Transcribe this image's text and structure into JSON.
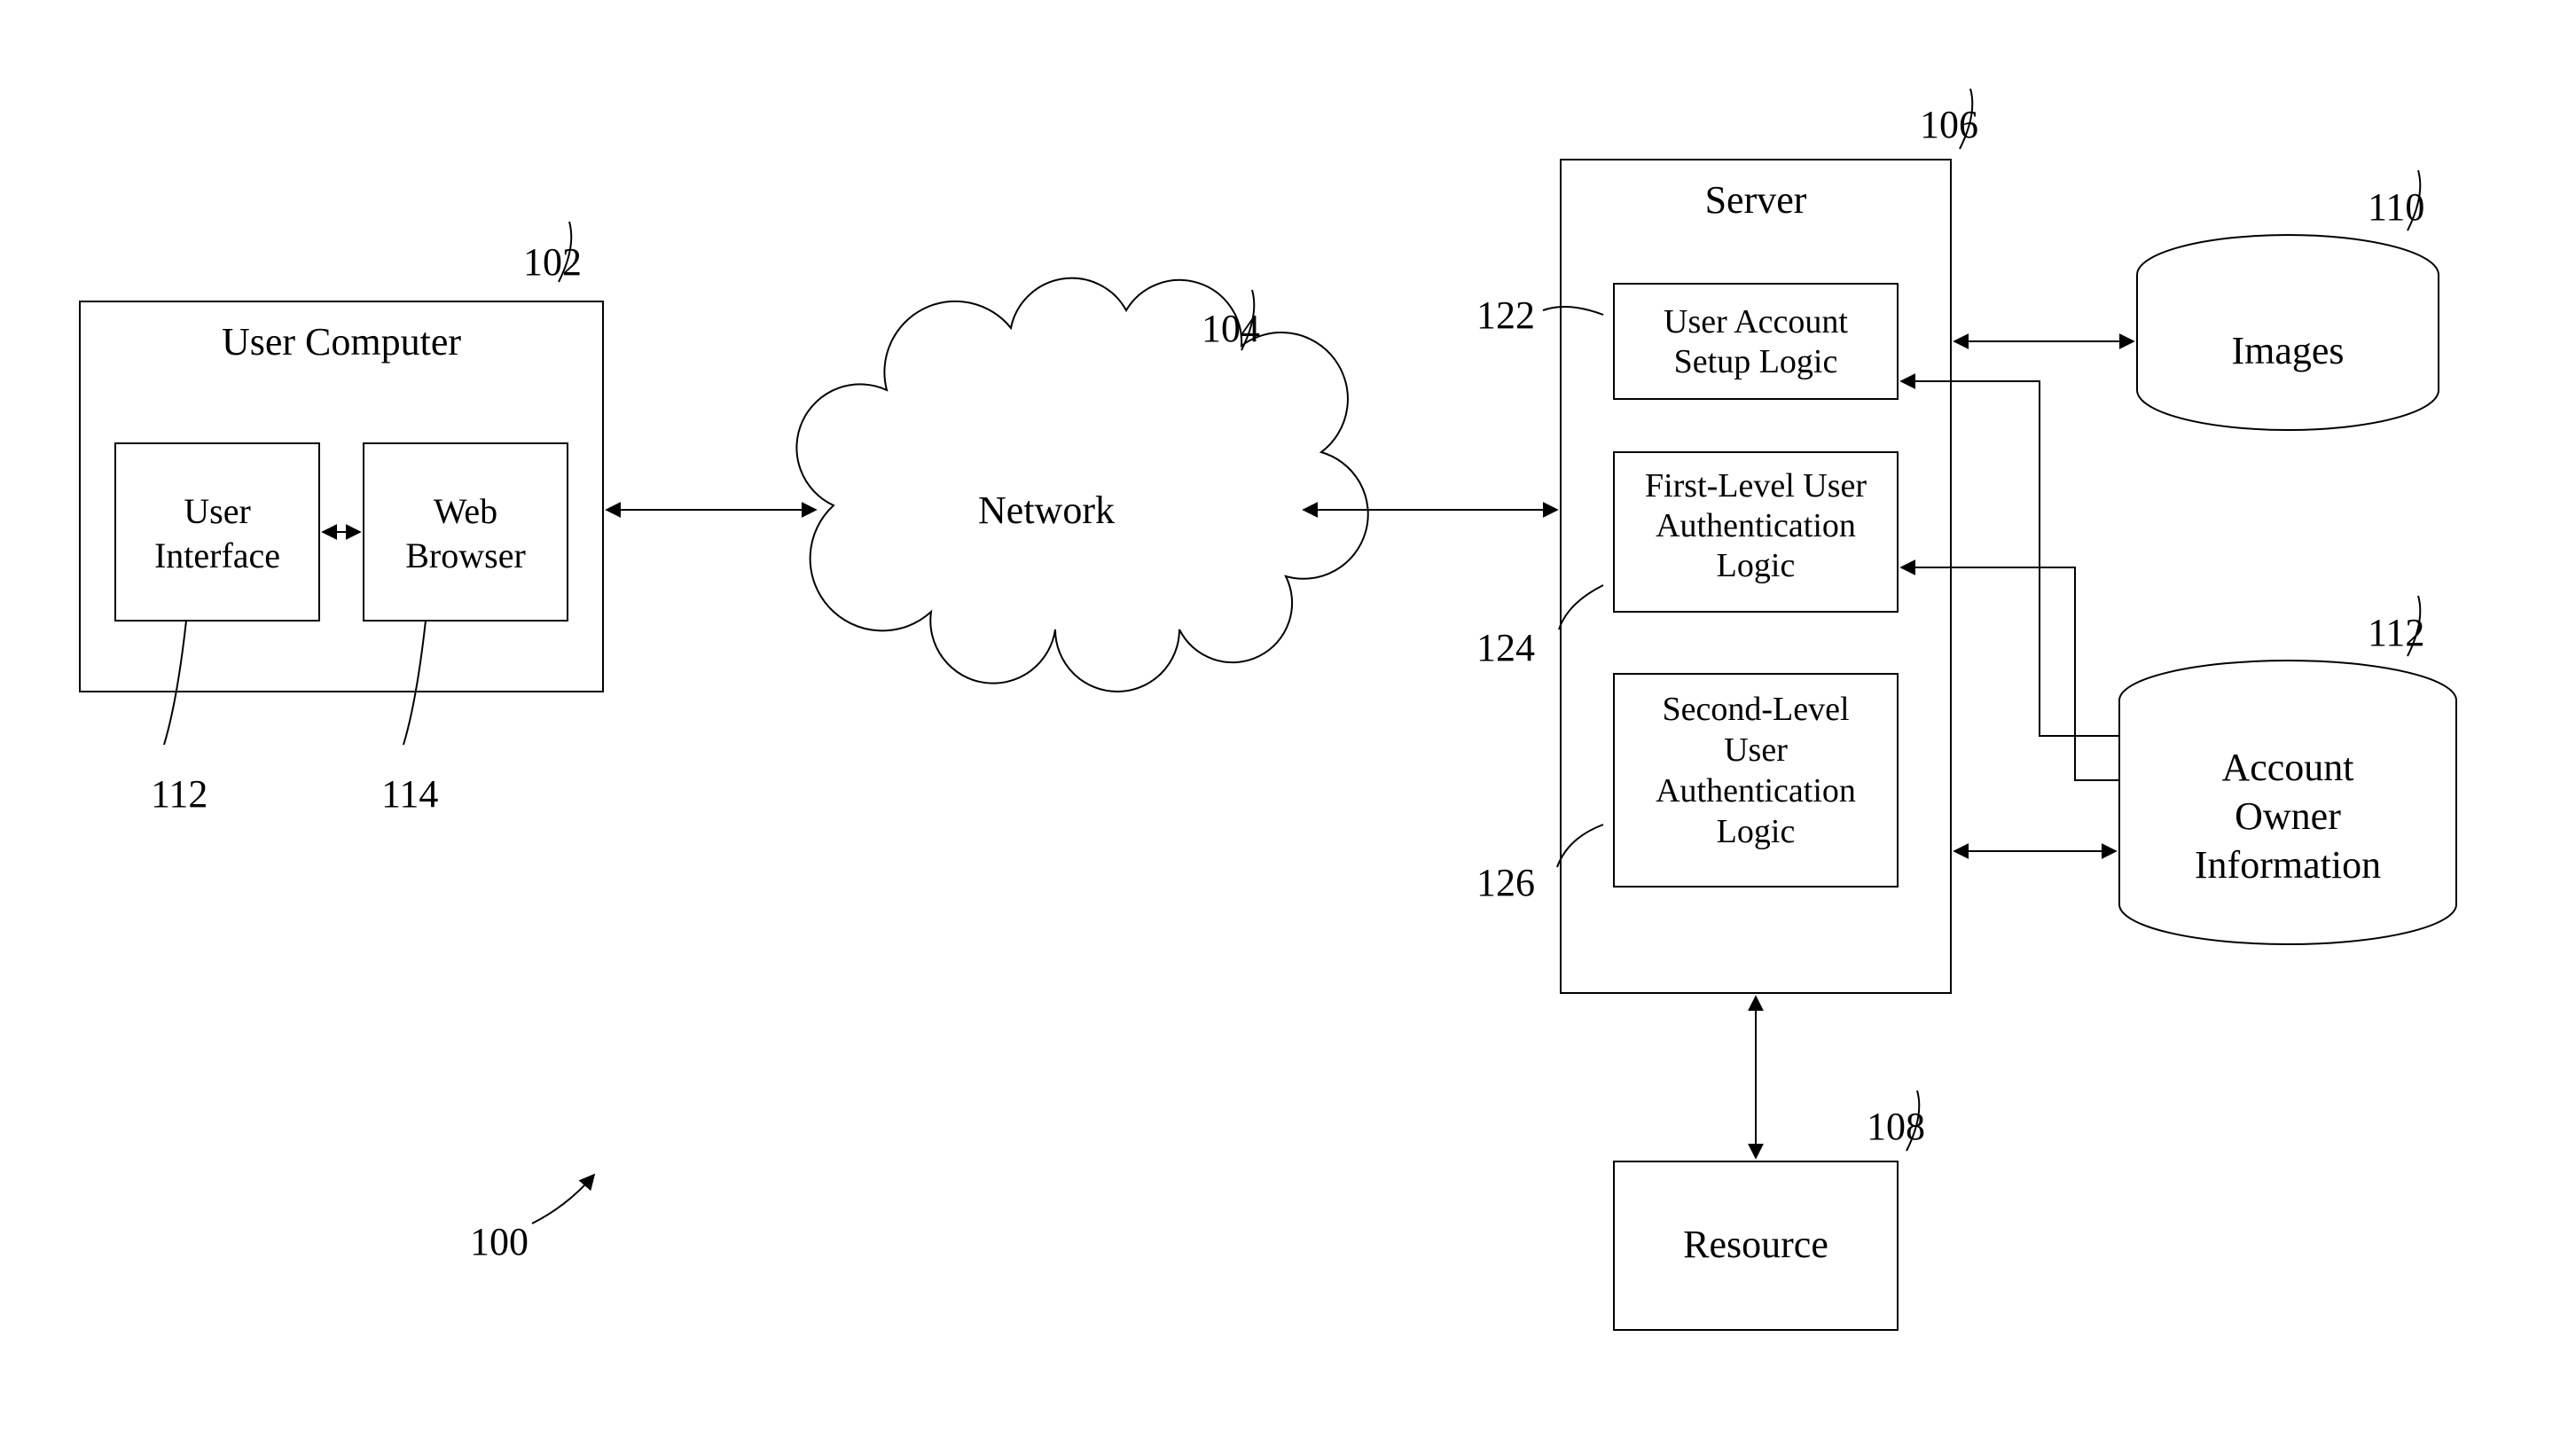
{
  "figure_ref": "100",
  "boxes": {
    "user_computer": {
      "ref": "102",
      "label": "User Computer"
    },
    "user_interface": {
      "ref": "112",
      "label_l1": "User",
      "label_l2": "Interface"
    },
    "web_browser": {
      "ref": "114",
      "label_l1": "Web",
      "label_l2": "Browser"
    },
    "network": {
      "ref": "104",
      "label": "Network"
    },
    "server": {
      "ref": "106",
      "label": "Server"
    },
    "setup_logic": {
      "ref": "122",
      "label_l1": "User Account",
      "label_l2": "Setup Logic"
    },
    "auth1_logic": {
      "ref": "124",
      "label_l1": "First-Level User",
      "label_l2": "Authentication",
      "label_l3": "Logic"
    },
    "auth2_logic": {
      "ref": "126",
      "label_l1": "Second-Level",
      "label_l2": "User",
      "label_l3": "Authentication",
      "label_l4": "Logic"
    },
    "resource": {
      "ref": "108",
      "label": "Resource"
    },
    "images_db": {
      "ref": "110",
      "label": "Images"
    },
    "account_db": {
      "ref": "112",
      "label_l1": "Account",
      "label_l2": "Owner",
      "label_l3": "Information"
    }
  }
}
